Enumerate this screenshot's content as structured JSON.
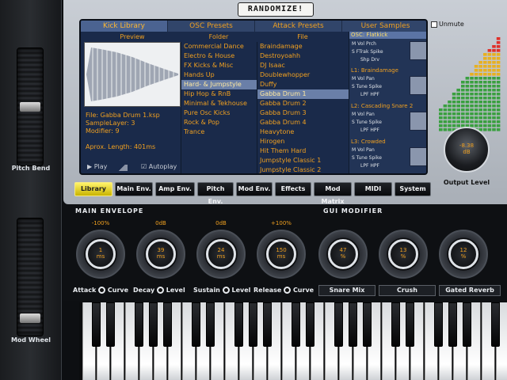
{
  "wheels": {
    "pitch_label": "Pitch Bend",
    "mod_label": "Mod Wheel"
  },
  "header": {
    "randomize": "RANDOMIZE!"
  },
  "tabs": [
    "Kick Library",
    "OSC Presets",
    "Attack Presets",
    "User Samples"
  ],
  "columns": {
    "preview": "Preview",
    "folder": "Folder",
    "file": "File"
  },
  "preview": {
    "file": "File: Gabba Drum 1.ksp",
    "sample_layer": "SampleLayer: 3",
    "modifier": "Modifier: 9",
    "length": "Aprox. Length: 401ms",
    "play": "Play",
    "autoplay": "Autoplay"
  },
  "folders": [
    "Commercial Dance",
    "Electro & House",
    "FX Kicks & Misc",
    "Hands Up",
    "Hard- & Jumpstyle",
    "Hip Hop & RnB",
    "Minimal & Tekhouse",
    "Pure Osc Kicks",
    "Rock & Pop",
    "Trance"
  ],
  "folder_selected": 4,
  "files": [
    "Braindamage",
    "Destroyoahh",
    "DJ Isaac",
    "Doublewhopper",
    "Duffy",
    "Gabba Drum 1",
    "Gabba Drum 2",
    "Gabba Drum 3",
    "Gabba Drum 4",
    "Heavytone",
    "Hirogen",
    "Hit Them Hard",
    "Jumpstyle Classic 1",
    "Jumpstyle Classic 2"
  ],
  "file_selected": 5,
  "osc": {
    "title": "OSC: Flatkick",
    "row1": "M  Vol  Prch",
    "row2": "S  FTrak  Spike",
    "row3": "Shp  Drv"
  },
  "layers": [
    {
      "title": "L1: Braindamage",
      "row1": "M  Vol  Pan",
      "row2": "S  Tune  Spike",
      "row3": "LPF  HPF"
    },
    {
      "title": "L2: Cascading Snare 2",
      "row1": "M  Vol  Pan",
      "row2": "S  Tune  Spike",
      "row3": "LPF  HPF"
    },
    {
      "title": "L3: Crowded",
      "row1": "M  Vol  Pan",
      "row2": "S  Tune  Spike",
      "row3": "LPF  HPF"
    }
  ],
  "unmute": "Unmute",
  "output": {
    "value": "-8.38",
    "unit": "dB",
    "label": "Output Level"
  },
  "nav": [
    "Library",
    "Main Env.",
    "Amp Env.",
    "Pitch Env.",
    "Mod Env.",
    "Effects",
    "Mod Matrix",
    "MIDI",
    "System"
  ],
  "nav_active": 0,
  "main_env": {
    "title": "MAIN ENVELOPE",
    "knobs": [
      {
        "top": "-100%",
        "value": "1",
        "unit": "ms"
      },
      {
        "top": "0dB",
        "value": "39",
        "unit": "ms"
      },
      {
        "top": "0dB",
        "value": "24",
        "unit": "ms"
      },
      {
        "top": "+100%",
        "value": "150",
        "unit": "ms"
      }
    ],
    "labels": [
      {
        "left": "Attack",
        "right": "Curve"
      },
      {
        "left": "Decay",
        "right": "Level"
      },
      {
        "left": "Sustain",
        "right": "Level"
      },
      {
        "left": "Release",
        "right": "Curve"
      }
    ]
  },
  "gui_mod": {
    "title": "GUI MODIFIER",
    "knobs": [
      {
        "value": "47",
        "unit": "%",
        "label": "Snare Mix"
      },
      {
        "value": "13",
        "unit": "%",
        "label": "Crush"
      },
      {
        "value": "12",
        "unit": "%",
        "label": "Gated Reverb"
      }
    ]
  },
  "colors": {
    "accent": "#f0a020",
    "active_button": "#e8dc2a",
    "screen_bg": "#1a2a4a"
  }
}
